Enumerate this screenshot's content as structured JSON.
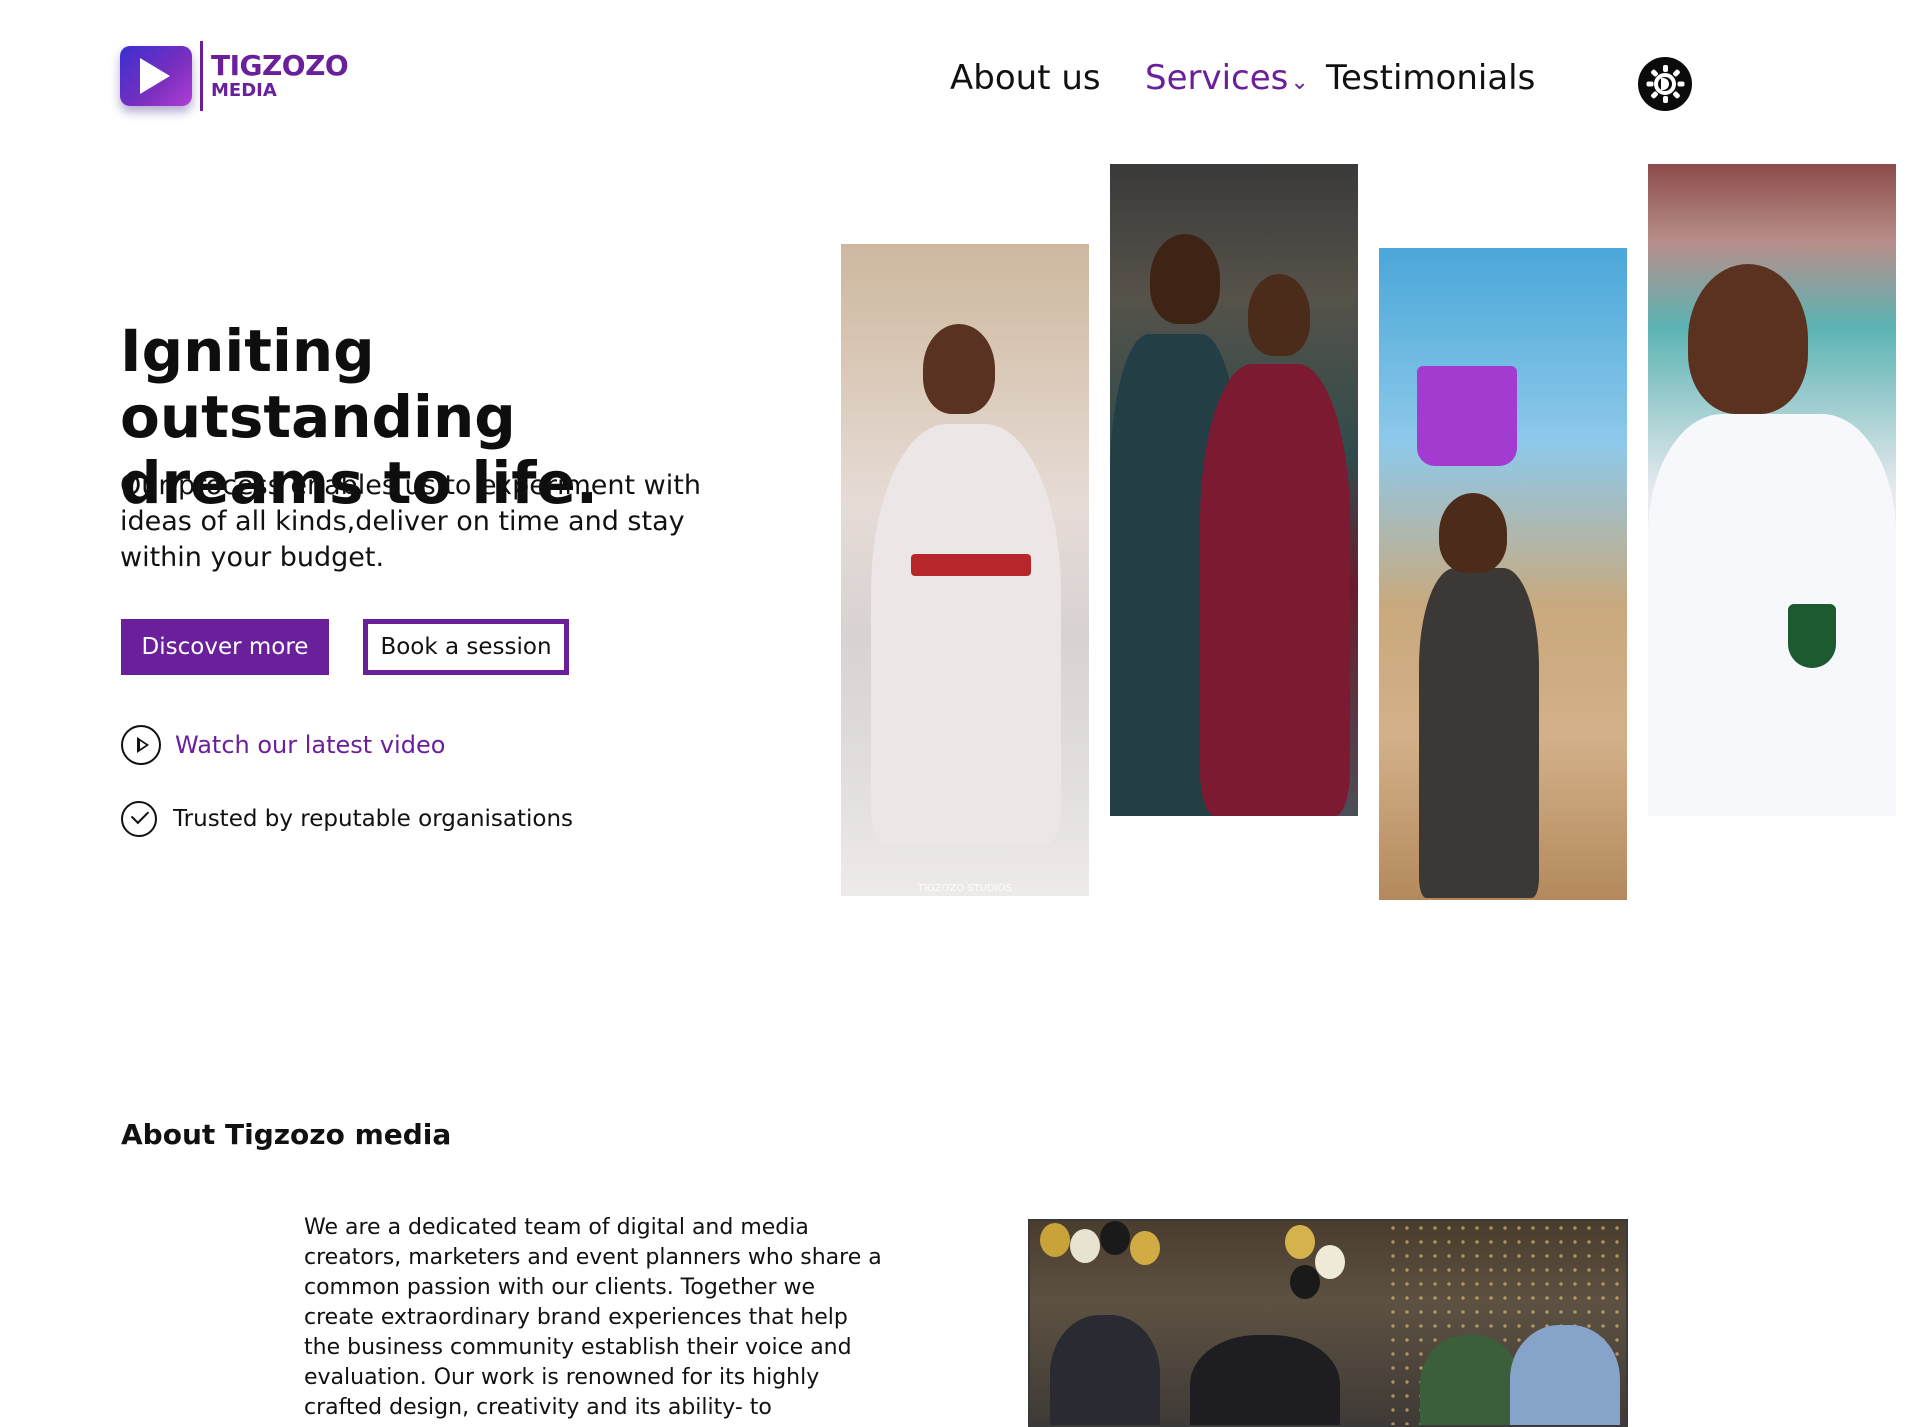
{
  "header": {
    "logo": {
      "line1": "TIGZOZO",
      "line2": "MEDIA",
      "icon": "play-icon",
      "brand_color": "#6a1f9b"
    },
    "nav": [
      {
        "label": "About us",
        "active": false
      },
      {
        "label": "Services",
        "active": true,
        "has_dropdown": true,
        "icon": "chevron-down-icon"
      },
      {
        "label": "Testimonials",
        "active": false
      }
    ],
    "theme_toggle": {
      "icon": "sun-moon-icon",
      "color": "#0b0b0b"
    }
  },
  "hero": {
    "title": "Igniting outstanding dreams to life.",
    "description": "Our process enables us to experiment with ideas of all kinds,deliver on time and stay within your budget.",
    "buttons": {
      "discover": "Discover more",
      "book": "Book a session"
    },
    "watch_video": {
      "label": "Watch our latest video",
      "icon": "play-circle-icon"
    },
    "trusted": {
      "label": "Trusted by reputable organisations",
      "icon": "check-circle-icon"
    },
    "photos": [
      {
        "name": "woman-in-white-dress-photo",
        "watermark": "TIGZOZO STUDIOS"
      },
      {
        "name": "couple-portrait-photo"
      },
      {
        "name": "girl-with-purple-bucket-photo"
      },
      {
        "name": "student-in-blazer-photo"
      }
    ]
  },
  "about": {
    "heading": "About Tigzozo media",
    "body": "We are a dedicated team of digital and media creators, marketers and event planners who share a common passion with our clients. Together we create extraordinary brand experiences that help the business community establish their voice and evaluation. Our work is renowned for its highly crafted design, creativity and its ability- to",
    "photo": {
      "name": "event-celebration-photo"
    }
  },
  "colors": {
    "accent": "#6a1f9b",
    "text": "#111111",
    "background": "#ffffff"
  }
}
